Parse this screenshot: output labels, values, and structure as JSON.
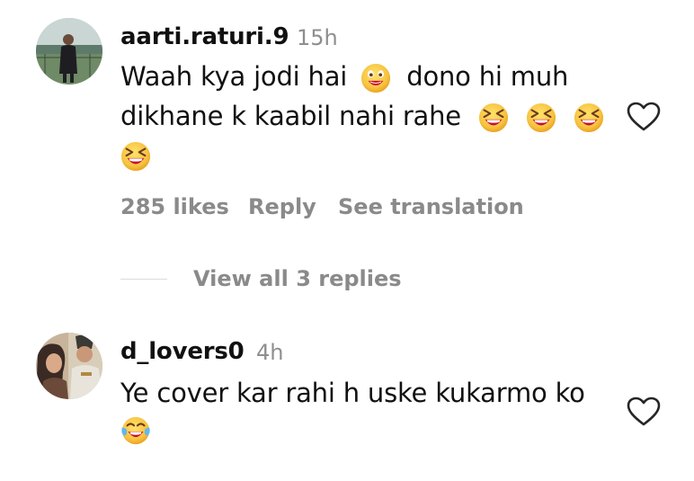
{
  "comments": [
    {
      "username": "aarti.raturi.9",
      "time": "15h",
      "line1_a": "Waah kya jodi hai",
      "line1_b": "dono hi muh",
      "line2": "dikhane k kaabil nahi rahe",
      "likes": "285 likes",
      "reply": "Reply",
      "translation": "See translation",
      "view_replies": "View all 3 replies",
      "icons": [
        "grinning-face-icon",
        "laughing-face-icon",
        "heart-icon"
      ]
    },
    {
      "username": "d_lovers0",
      "time": "4h",
      "line1": "Ye cover kar rahi h uske kukarmo ko",
      "icons": [
        "tears-of-joy-icon",
        "heart-icon"
      ]
    }
  ],
  "colors": {
    "text": "#111111",
    "muted": "#8e8e8e",
    "emoji_yellow": "#f7c340",
    "emoji_mouth": "#c8102e"
  }
}
